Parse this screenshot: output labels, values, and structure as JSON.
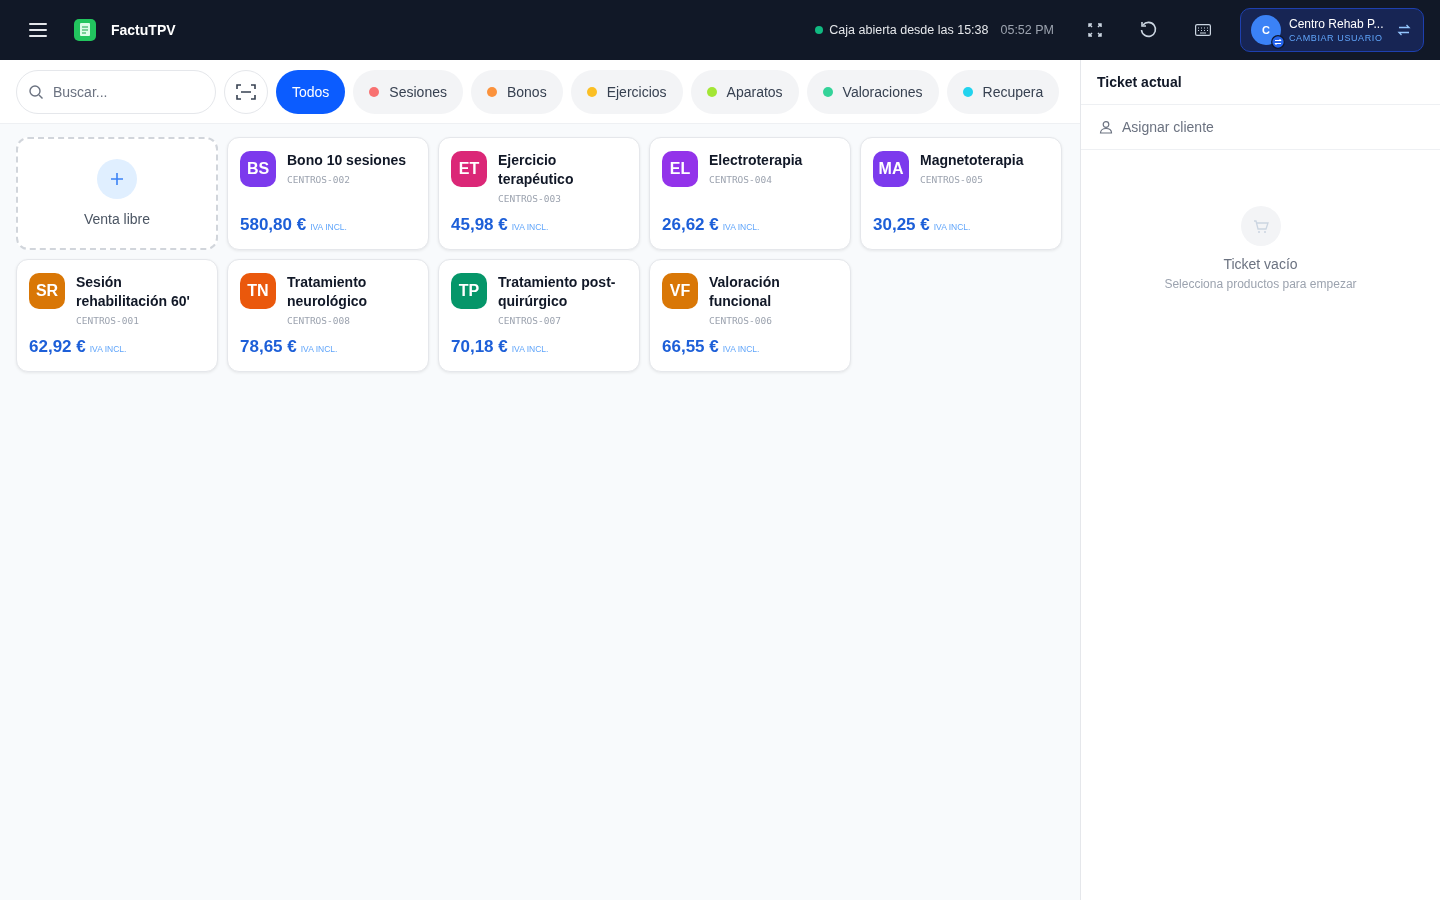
{
  "app": {
    "name": "FactuTPV"
  },
  "header": {
    "status": "Caja abierta desde las 15:38",
    "clock": "05:52 PM",
    "user": {
      "avatar_initial": "C",
      "name": "Centro Rehab P...",
      "action": "CAMBIAR USUARIO"
    }
  },
  "search": {
    "placeholder": "Buscar..."
  },
  "categories": [
    {
      "label": "Todos",
      "selected": true
    },
    {
      "label": "Sesiones",
      "selected": false,
      "color": "#f87171"
    },
    {
      "label": "Bonos",
      "selected": false,
      "color": "#fb923c"
    },
    {
      "label": "Ejercicios",
      "selected": false,
      "color": "#fbbf24"
    },
    {
      "label": "Aparatos",
      "selected": false,
      "color": "#a3e635"
    },
    {
      "label": "Valoraciones",
      "selected": false,
      "color": "#34d399"
    },
    {
      "label": "Recupera",
      "selected": false,
      "color": "#22d3ee"
    }
  ],
  "free_sale": {
    "label": "Venta libre"
  },
  "products": [
    {
      "initials": "BS",
      "color": "#7c3aed",
      "name": "Bono 10 sesiones",
      "code": "CENTROS-002",
      "price": "580,80 €",
      "tax": "IVA INCL."
    },
    {
      "initials": "ET",
      "color": "#db2777",
      "name": "Ejercicio terapéutico",
      "code": "CENTROS-003",
      "price": "45,98 €",
      "tax": "IVA INCL."
    },
    {
      "initials": "EL",
      "color": "#9333ea",
      "name": "Electroterapia",
      "code": "CENTROS-004",
      "price": "26,62 €",
      "tax": "IVA INCL."
    },
    {
      "initials": "MA",
      "color": "#7c3aed",
      "name": "Magnetoterapia",
      "code": "CENTROS-005",
      "price": "30,25 €",
      "tax": "IVA INCL."
    },
    {
      "initials": "SR",
      "color": "#d97706",
      "name": "Sesión rehabilitación 60'",
      "code": "CENTROS-001",
      "price": "62,92 €",
      "tax": "IVA INCL."
    },
    {
      "initials": "TN",
      "color": "#ea580c",
      "name": "Tratamiento neurológico",
      "code": "CENTROS-008",
      "price": "78,65 €",
      "tax": "IVA INCL."
    },
    {
      "initials": "TP",
      "color": "#059669",
      "name": "Tratamiento post-quirúrgico",
      "code": "CENTROS-007",
      "price": "70,18 €",
      "tax": "IVA INCL."
    },
    {
      "initials": "VF",
      "color": "#d97706",
      "name": "Valoración funcional",
      "code": "CENTROS-006",
      "price": "66,55 €",
      "tax": "IVA INCL."
    }
  ],
  "ticket": {
    "title": "Ticket actual",
    "assign_client": "Asignar cliente",
    "empty_title": "Ticket vacío",
    "empty_hint": "Selecciona productos para empezar"
  }
}
